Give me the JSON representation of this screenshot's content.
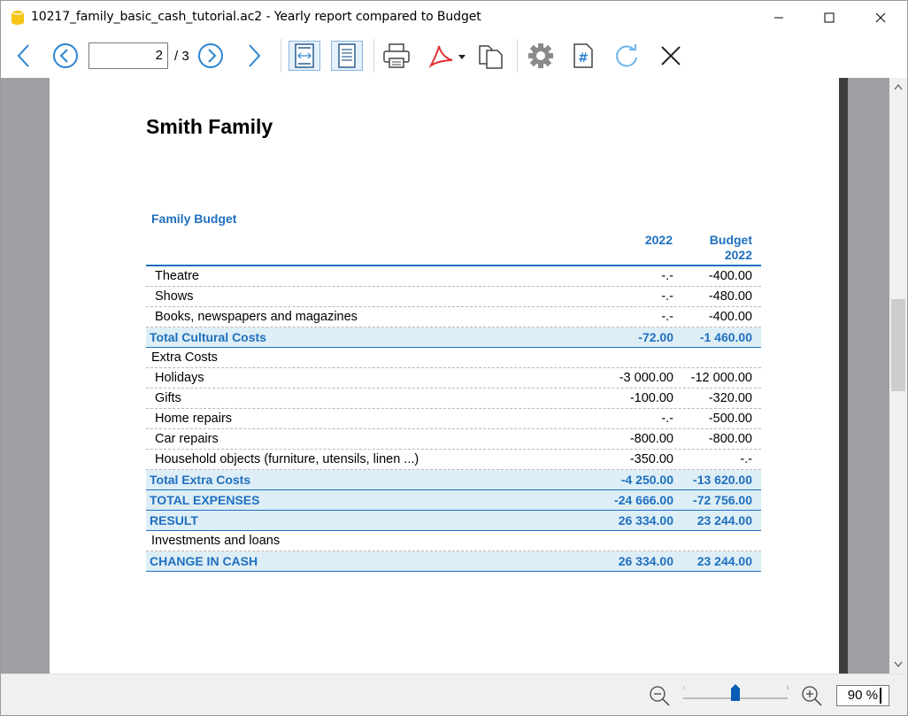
{
  "window": {
    "title": "10217_family_basic_cash_tutorial.ac2 - Yearly report compared to Budget"
  },
  "toolbar": {
    "current_page": "2",
    "page_total": "/ 3",
    "icons": [
      "arrow-left-icon",
      "circle-left-icon",
      "circle-right-icon",
      "arrow-right-icon",
      "fit-width-icon",
      "fit-page-icon",
      "printer-icon",
      "pdf-icon",
      "copy-icon",
      "gear-icon",
      "hash-icon",
      "refresh-icon",
      "close-icon"
    ]
  },
  "report": {
    "title": "Smith Family",
    "section": "Family Budget",
    "col1_header": "2022",
    "col2_header_line1": "Budget",
    "col2_header_line2": "2022",
    "rows": [
      {
        "label": "Theatre",
        "v1": "-.-",
        "v2": "-400.00",
        "type": "item"
      },
      {
        "label": "Shows",
        "v1": "-.-",
        "v2": "-480.00",
        "type": "item"
      },
      {
        "label": "Books, newspapers and magazines",
        "v1": "-.-",
        "v2": "-400.00",
        "type": "item"
      },
      {
        "label": "Total Cultural Costs",
        "v1": "-72.00",
        "v2": "-1 460.00",
        "type": "total"
      },
      {
        "label": "Extra Costs",
        "v1": "",
        "v2": "",
        "type": "group"
      },
      {
        "label": "Holidays",
        "v1": "-3 000.00",
        "v2": "-12 000.00",
        "type": "item"
      },
      {
        "label": "Gifts",
        "v1": "-100.00",
        "v2": "-320.00",
        "type": "item"
      },
      {
        "label": "Home repairs",
        "v1": "-.-",
        "v2": "-500.00",
        "type": "item"
      },
      {
        "label": "Car repairs",
        "v1": "-800.00",
        "v2": "-800.00",
        "type": "item"
      },
      {
        "label": "Household objects (furniture, utensils, linen ...)",
        "v1": "-350.00",
        "v2": "-.-",
        "type": "item"
      },
      {
        "label": "Total Extra Costs",
        "v1": "-4 250.00",
        "v2": "-13 620.00",
        "type": "total"
      },
      {
        "label": "TOTAL EXPENSES",
        "v1": "-24 666.00",
        "v2": "-72 756.00",
        "type": "total"
      },
      {
        "label": "RESULT",
        "v1": "26 334.00",
        "v2": "23 244.00",
        "type": "total"
      },
      {
        "label": "Investments and loans",
        "v1": "",
        "v2": "",
        "type": "group"
      },
      {
        "label": "CHANGE IN CASH",
        "v1": "26 334.00",
        "v2": "23 244.00",
        "type": "total"
      }
    ]
  },
  "status": {
    "zoom": "90",
    "zoom_unit": "%",
    "zoom_level": 0.6
  },
  "colors": {
    "accent": "#1f6fbf",
    "total_bg": "#ddeef6",
    "workarea_bg": "#a0a0a4"
  }
}
